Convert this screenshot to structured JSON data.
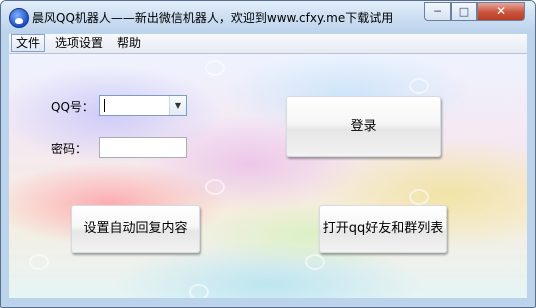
{
  "window": {
    "title": "晨风QQ机器人——新出微信机器人，欢迎到www.cfxy.me下载试用",
    "controls": {
      "minimize": "─",
      "maximize": "□",
      "close": "✕"
    }
  },
  "menu": [
    {
      "label": "文件"
    },
    {
      "label": "选项设置"
    },
    {
      "label": "帮助"
    }
  ],
  "form": {
    "qq_label": "QQ号：",
    "qq_value": "",
    "password_label": "密码：",
    "password_value": ""
  },
  "buttons": {
    "login": "登录",
    "auto_reply": "设置自动回复内容",
    "open_lists": "打开qq好友和群列表"
  }
}
